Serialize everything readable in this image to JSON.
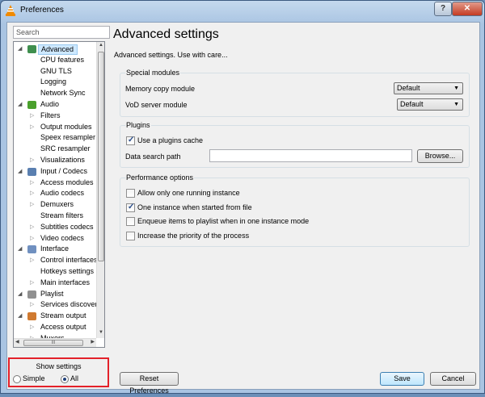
{
  "window": {
    "title": "Preferences",
    "help_label": "?",
    "close_label": "✕"
  },
  "sidebar": {
    "search_placeholder": "Search",
    "tree": [
      {
        "label": "Advanced",
        "level": 0,
        "icon": "advanced-icon",
        "selected": true
      },
      {
        "label": "CPU features",
        "level": 1
      },
      {
        "label": "GNU TLS",
        "level": 1
      },
      {
        "label": "Logging",
        "level": 1
      },
      {
        "label": "Network Sync",
        "level": 1
      },
      {
        "label": "Audio",
        "level": 0,
        "icon": "audio-icon"
      },
      {
        "label": "Filters",
        "level": 1,
        "expandable": true
      },
      {
        "label": "Output modules",
        "level": 1,
        "expandable": true
      },
      {
        "label": "Speex resampler",
        "level": 1
      },
      {
        "label": "SRC resampler",
        "level": 1
      },
      {
        "label": "Visualizations",
        "level": 1,
        "expandable": true
      },
      {
        "label": "Input / Codecs",
        "level": 0,
        "icon": "input-codecs-icon"
      },
      {
        "label": "Access modules",
        "level": 1,
        "expandable": true
      },
      {
        "label": "Audio codecs",
        "level": 1,
        "expandable": true
      },
      {
        "label": "Demuxers",
        "level": 1,
        "expandable": true
      },
      {
        "label": "Stream filters",
        "level": 1
      },
      {
        "label": "Subtitles codecs",
        "level": 1,
        "expandable": true
      },
      {
        "label": "Video codecs",
        "level": 1,
        "expandable": true
      },
      {
        "label": "Interface",
        "level": 0,
        "icon": "interface-icon"
      },
      {
        "label": "Control interfaces",
        "level": 1,
        "expandable": true
      },
      {
        "label": "Hotkeys settings",
        "level": 1
      },
      {
        "label": "Main interfaces",
        "level": 1,
        "expandable": true
      },
      {
        "label": "Playlist",
        "level": 0,
        "icon": "playlist-icon"
      },
      {
        "label": "Services discovery",
        "level": 1,
        "expandable": true
      },
      {
        "label": "Stream output",
        "level": 0,
        "icon": "stream-output-icon"
      },
      {
        "label": "Access output",
        "level": 1,
        "expandable": true
      },
      {
        "label": "Muxers",
        "level": 1,
        "expandable": true
      }
    ],
    "hscroll_grip": "III"
  },
  "show_settings": {
    "caption": "Show settings",
    "simple_label": "Simple",
    "all_label": "All",
    "selected": "All"
  },
  "main": {
    "heading": "Advanced settings",
    "subtitle": "Advanced settings. Use with care...",
    "special_modules": {
      "title": "Special modules",
      "memcpy_label": "Memory copy module",
      "memcpy_value": "Default",
      "vod_label": "VoD server module",
      "vod_value": "Default"
    },
    "plugins": {
      "title": "Plugins",
      "cache_label": "Use a plugins cache",
      "cache_checked": true,
      "path_label": "Data search path",
      "path_value": "",
      "browse_label": "Browse..."
    },
    "performance": {
      "title": "Performance options",
      "options": [
        {
          "label": "Allow only one running instance",
          "checked": false
        },
        {
          "label": "One instance when started from file",
          "checked": true
        },
        {
          "label": "Enqueue items to playlist when in one instance mode",
          "checked": false
        },
        {
          "label": "Increase the priority of the process",
          "checked": false
        }
      ]
    }
  },
  "footer": {
    "reset_label": "Reset Preferences",
    "save_label": "Save",
    "cancel_label": "Cancel"
  }
}
